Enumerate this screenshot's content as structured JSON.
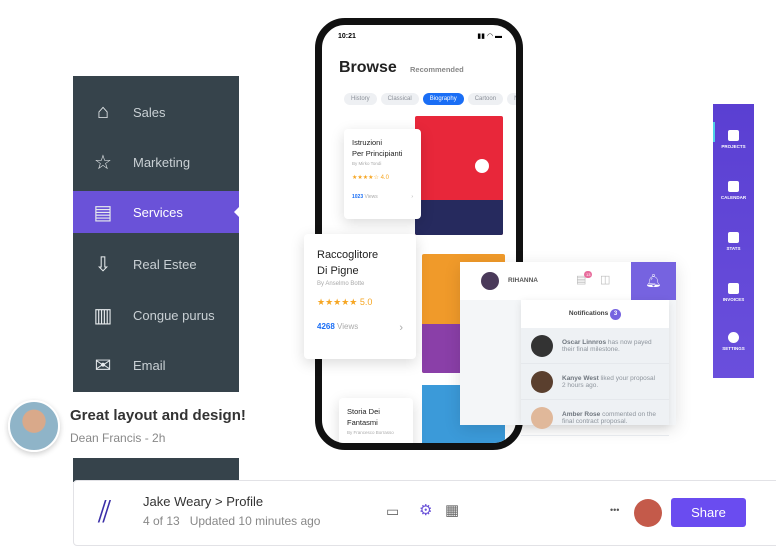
{
  "sidebar": {
    "items": [
      {
        "label": "Sales",
        "icon": "home-icon"
      },
      {
        "label": "Marketing",
        "icon": "star-icon"
      },
      {
        "label": "Services",
        "icon": "document-icon",
        "active": true
      },
      {
        "label": "Real Estee",
        "icon": "download-icon"
      },
      {
        "label": "Congue purus",
        "icon": "bar-chart-icon"
      },
      {
        "label": "Email",
        "icon": "mail-icon"
      }
    ]
  },
  "phone": {
    "time": "10:21",
    "title": "Browse",
    "subtitle": "Recommended",
    "chips": [
      "History",
      "Classical",
      "Biography",
      "Cartoon",
      "N"
    ],
    "books": [
      {
        "title1": "Istruzioni",
        "title2": "Per Principianti",
        "author": "By Mirko Tondi",
        "stars": "★★★★☆",
        "rating": "4.0",
        "views": "1023",
        "views_label": "Views"
      },
      {
        "title1": "Raccoglitore",
        "title2": "Di Pigne",
        "author": "By Anselmo Botte",
        "stars": "★★★★★",
        "rating": "5.0",
        "views": "4268",
        "views_label": "Views"
      },
      {
        "title1": "Storia Dei",
        "title2": "Fantasmi",
        "author": "By Francesco Borrasso"
      }
    ]
  },
  "testimonial": {
    "quote": "Great layout and design!",
    "author": "Dean Francis - 2h"
  },
  "notifications": {
    "user": "RIHANNA",
    "badge": "13",
    "title": "Notifications",
    "count": "3",
    "items": [
      {
        "name": "Oscar Linnros",
        "text1": " has now payed",
        "text2": "their final milestone."
      },
      {
        "name": "Kanye West",
        "text1": " liked your proposal",
        "text2": "2 hours ago."
      },
      {
        "name": "Amber Rose",
        "text1": " commented on the",
        "text2": "final contract proposal."
      }
    ]
  },
  "right_nav": [
    "PROJECTS",
    "CALENDAR",
    "STATS",
    "INVOICES",
    "SETTINGS"
  ],
  "bottom": {
    "user": "Jake Weary",
    "sep": ">",
    "page": "Profile",
    "position": "4 of 13",
    "updated": "Updated 10 minutes ago",
    "share": "Share",
    "more": "•••"
  },
  "colors": {
    "accent": "#6a52d8",
    "sidebar": "#36434b",
    "blue": "#1a6ef5"
  }
}
